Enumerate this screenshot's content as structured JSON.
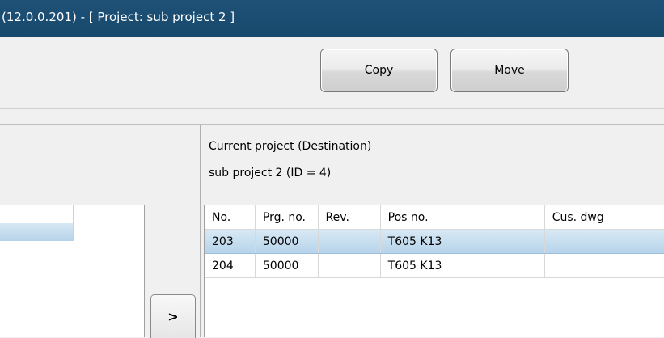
{
  "window": {
    "title": "(12.0.0.201) -  [ Project: sub project 2 ]"
  },
  "toolbar": {
    "copy_label": "Copy",
    "move_label": "Move"
  },
  "transfer": {
    "arrow_label": ">"
  },
  "destination": {
    "heading": "Current project (Destination)",
    "project": "sub project 2 (ID = 4)"
  },
  "table": {
    "columns": [
      "No.",
      "Prg. no.",
      "Rev.",
      "Pos no.",
      "Cus. dwg"
    ],
    "rows": [
      {
        "no": "203",
        "prg": "50000",
        "rev": "",
        "pos": "T605 K13",
        "cus": "",
        "selected": true
      },
      {
        "no": "204",
        "prg": "50000",
        "rev": "",
        "pos": "T605 K13",
        "cus": "",
        "selected": false
      }
    ]
  },
  "colors": {
    "titlebar": "#1f5177",
    "selection": "#b6d3ea"
  }
}
